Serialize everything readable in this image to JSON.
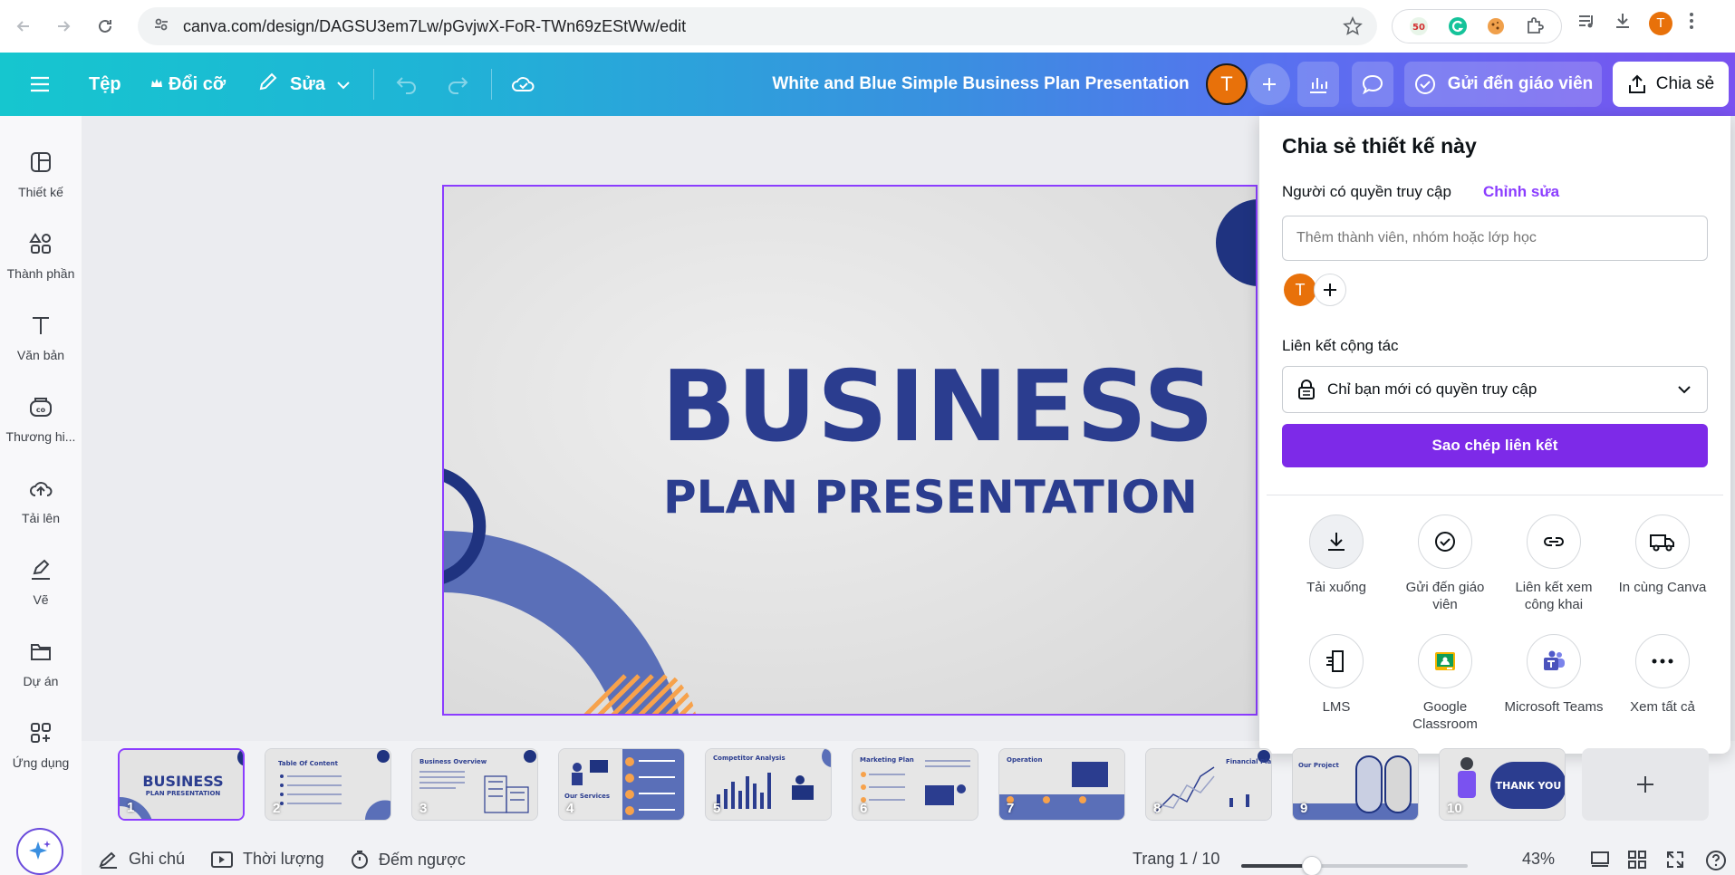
{
  "browser": {
    "url": "canva.com/design/DAGSU3em7Lw/pGvjwX-FoR-TWn69zEStWw/edit",
    "avatar_letter": "T",
    "ext_badge": "50"
  },
  "header": {
    "file_label": "Tệp",
    "resize_label": "Đổi cỡ",
    "edit_label": "Sửa",
    "title": "White and Blue Simple Business Plan Presentation",
    "avatar_letter": "T",
    "send_teacher_label": "Gửi đến giáo viên",
    "share_label": "Chia sẻ"
  },
  "sidebar": {
    "items": [
      {
        "label": "Thiết kế",
        "icon": "design-icon"
      },
      {
        "label": "Thành phần",
        "icon": "elements-icon"
      },
      {
        "label": "Văn bản",
        "icon": "text-icon"
      },
      {
        "label": "Thương hi...",
        "icon": "brand-icon"
      },
      {
        "label": "Tải lên",
        "icon": "upload-icon"
      },
      {
        "label": "Vẽ",
        "icon": "draw-icon"
      },
      {
        "label": "Dự án",
        "icon": "folder-icon"
      },
      {
        "label": "Ứng dụng",
        "icon": "apps-icon"
      }
    ]
  },
  "slide": {
    "title": "BUSINESS",
    "subtitle": "PLAN PRESENTATION",
    "primary_color": "#2b3d8f",
    "accent_color": "#f7a24b"
  },
  "share_panel": {
    "title": "Chia sẻ thiết kế này",
    "access_label": "Người có quyền truy cập",
    "edit_link": "Chỉnh sửa",
    "input_placeholder": "Thêm thành viên, nhóm hoặc lớp học",
    "member_letter": "T",
    "collab_label": "Liên kết cộng tác",
    "access_option": "Chỉ bạn mới có quyền truy cập",
    "copy_button": "Sao chép liên kết",
    "options": [
      {
        "label": "Tải xuống",
        "icon": "download-icon"
      },
      {
        "label": "Gửi đến giáo viên",
        "icon": "check-circle-icon"
      },
      {
        "label": "Liên kết xem công khai",
        "icon": "link-icon"
      },
      {
        "label": "In cùng Canva",
        "icon": "truck-icon"
      },
      {
        "label": "LMS",
        "icon": "lms-icon"
      },
      {
        "label": "Google Classroom",
        "icon": "google-classroom-icon"
      },
      {
        "label": "Microsoft Teams",
        "icon": "teams-icon"
      },
      {
        "label": "Xem tất cả",
        "icon": "more-icon"
      }
    ]
  },
  "thumbnails": [
    {
      "num": "1",
      "heading": "BUSINESS",
      "sub": "PLAN PRESENTATION"
    },
    {
      "num": "2",
      "heading": "Table Of Content"
    },
    {
      "num": "3",
      "heading": "Business Overview"
    },
    {
      "num": "4",
      "heading": "Our Services"
    },
    {
      "num": "5",
      "heading": "Competitor Analysis"
    },
    {
      "num": "6",
      "heading": "Marketing Plan"
    },
    {
      "num": "7",
      "heading": "Operation"
    },
    {
      "num": "8",
      "heading": "Financial Plan"
    },
    {
      "num": "9",
      "heading": "Our Project"
    },
    {
      "num": "10",
      "heading": "THANK YOU"
    }
  ],
  "footer": {
    "notes_label": "Ghi chú",
    "duration_label": "Thời lượng",
    "timer_label": "Đếm ngược",
    "page_indicator": "Trang 1 / 10",
    "zoom": "43%",
    "zoom_fraction": 0.31
  }
}
